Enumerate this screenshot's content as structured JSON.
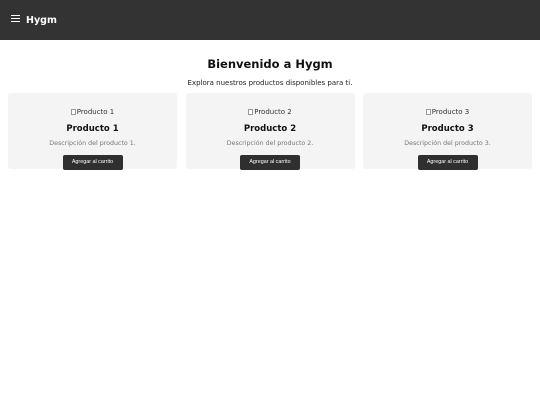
{
  "header": {
    "brand": "Hygm",
    "menu_icon": "hamburger-menu-icon"
  },
  "main": {
    "title": "Bienvenido a Hygm",
    "subtitle": "Explora nuestros productos disponibles para ti."
  },
  "products": [
    {
      "image_alt": "Producto 1",
      "title": "Producto 1",
      "description": "Descripción del producto 1.",
      "button_label": "Agregar al carrito"
    },
    {
      "image_alt": "Producto 2",
      "title": "Producto 2",
      "description": "Descripción del producto 2.",
      "button_label": "Agregar al carrito"
    },
    {
      "image_alt": "Producto 3",
      "title": "Producto 3",
      "description": "Descripción del producto 3.",
      "button_label": "Agregar al carrito"
    }
  ],
  "colors": {
    "header_bg": "#333333",
    "card_bg": "#f4f4f4",
    "button_bg": "#2f2f2f"
  }
}
